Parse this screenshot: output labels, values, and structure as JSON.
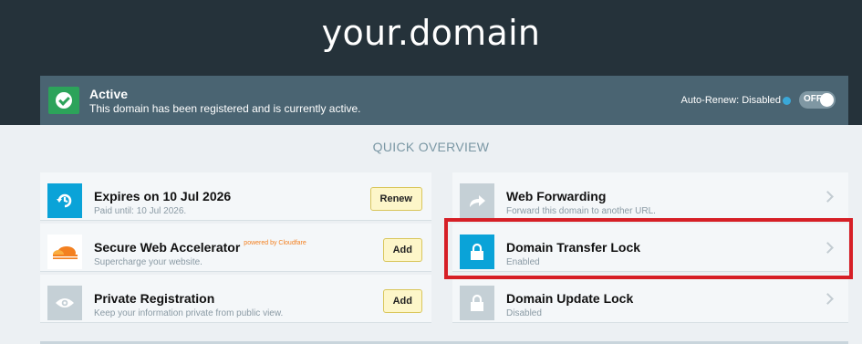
{
  "header": {
    "domain": "your.domain"
  },
  "status": {
    "title": "Active",
    "description": "This domain has been registered and is currently active.",
    "autorenew_label": "Auto-Renew: Disabled",
    "toggle_label": "OFF",
    "color": "#2ca35a"
  },
  "overview": {
    "title": "QUICK OVERVIEW",
    "left": [
      {
        "title": "Expires on 10 Jul 2026",
        "subtitle": "Paid until: 10 Jul 2026.",
        "button": "Renew",
        "icon": "expiry-clock-icon"
      },
      {
        "title": "Secure Web Accelerator",
        "badge": "powered by Cloudfare",
        "subtitle": "Supercharge your website.",
        "button": "Add",
        "icon": "cloudflare-logo"
      },
      {
        "title": "Private Registration",
        "subtitle": "Keep your information private from public view.",
        "button": "Add",
        "icon": "eye-icon"
      }
    ],
    "right": [
      {
        "title": "Web Forwarding",
        "subtitle": "Forward this domain to another URL.",
        "icon": "forward-arrow-icon"
      },
      {
        "title": "Domain Transfer Lock",
        "subtitle": "Enabled",
        "icon": "lock-icon"
      },
      {
        "title": "Domain Update Lock",
        "subtitle": "Disabled",
        "icon": "lock-icon"
      }
    ]
  },
  "colors": {
    "accent_blue": "#0aa3d8",
    "disabled_grey": "#c5d0d6",
    "highlight_red": "#d61f26",
    "header_dark": "#25323a"
  }
}
